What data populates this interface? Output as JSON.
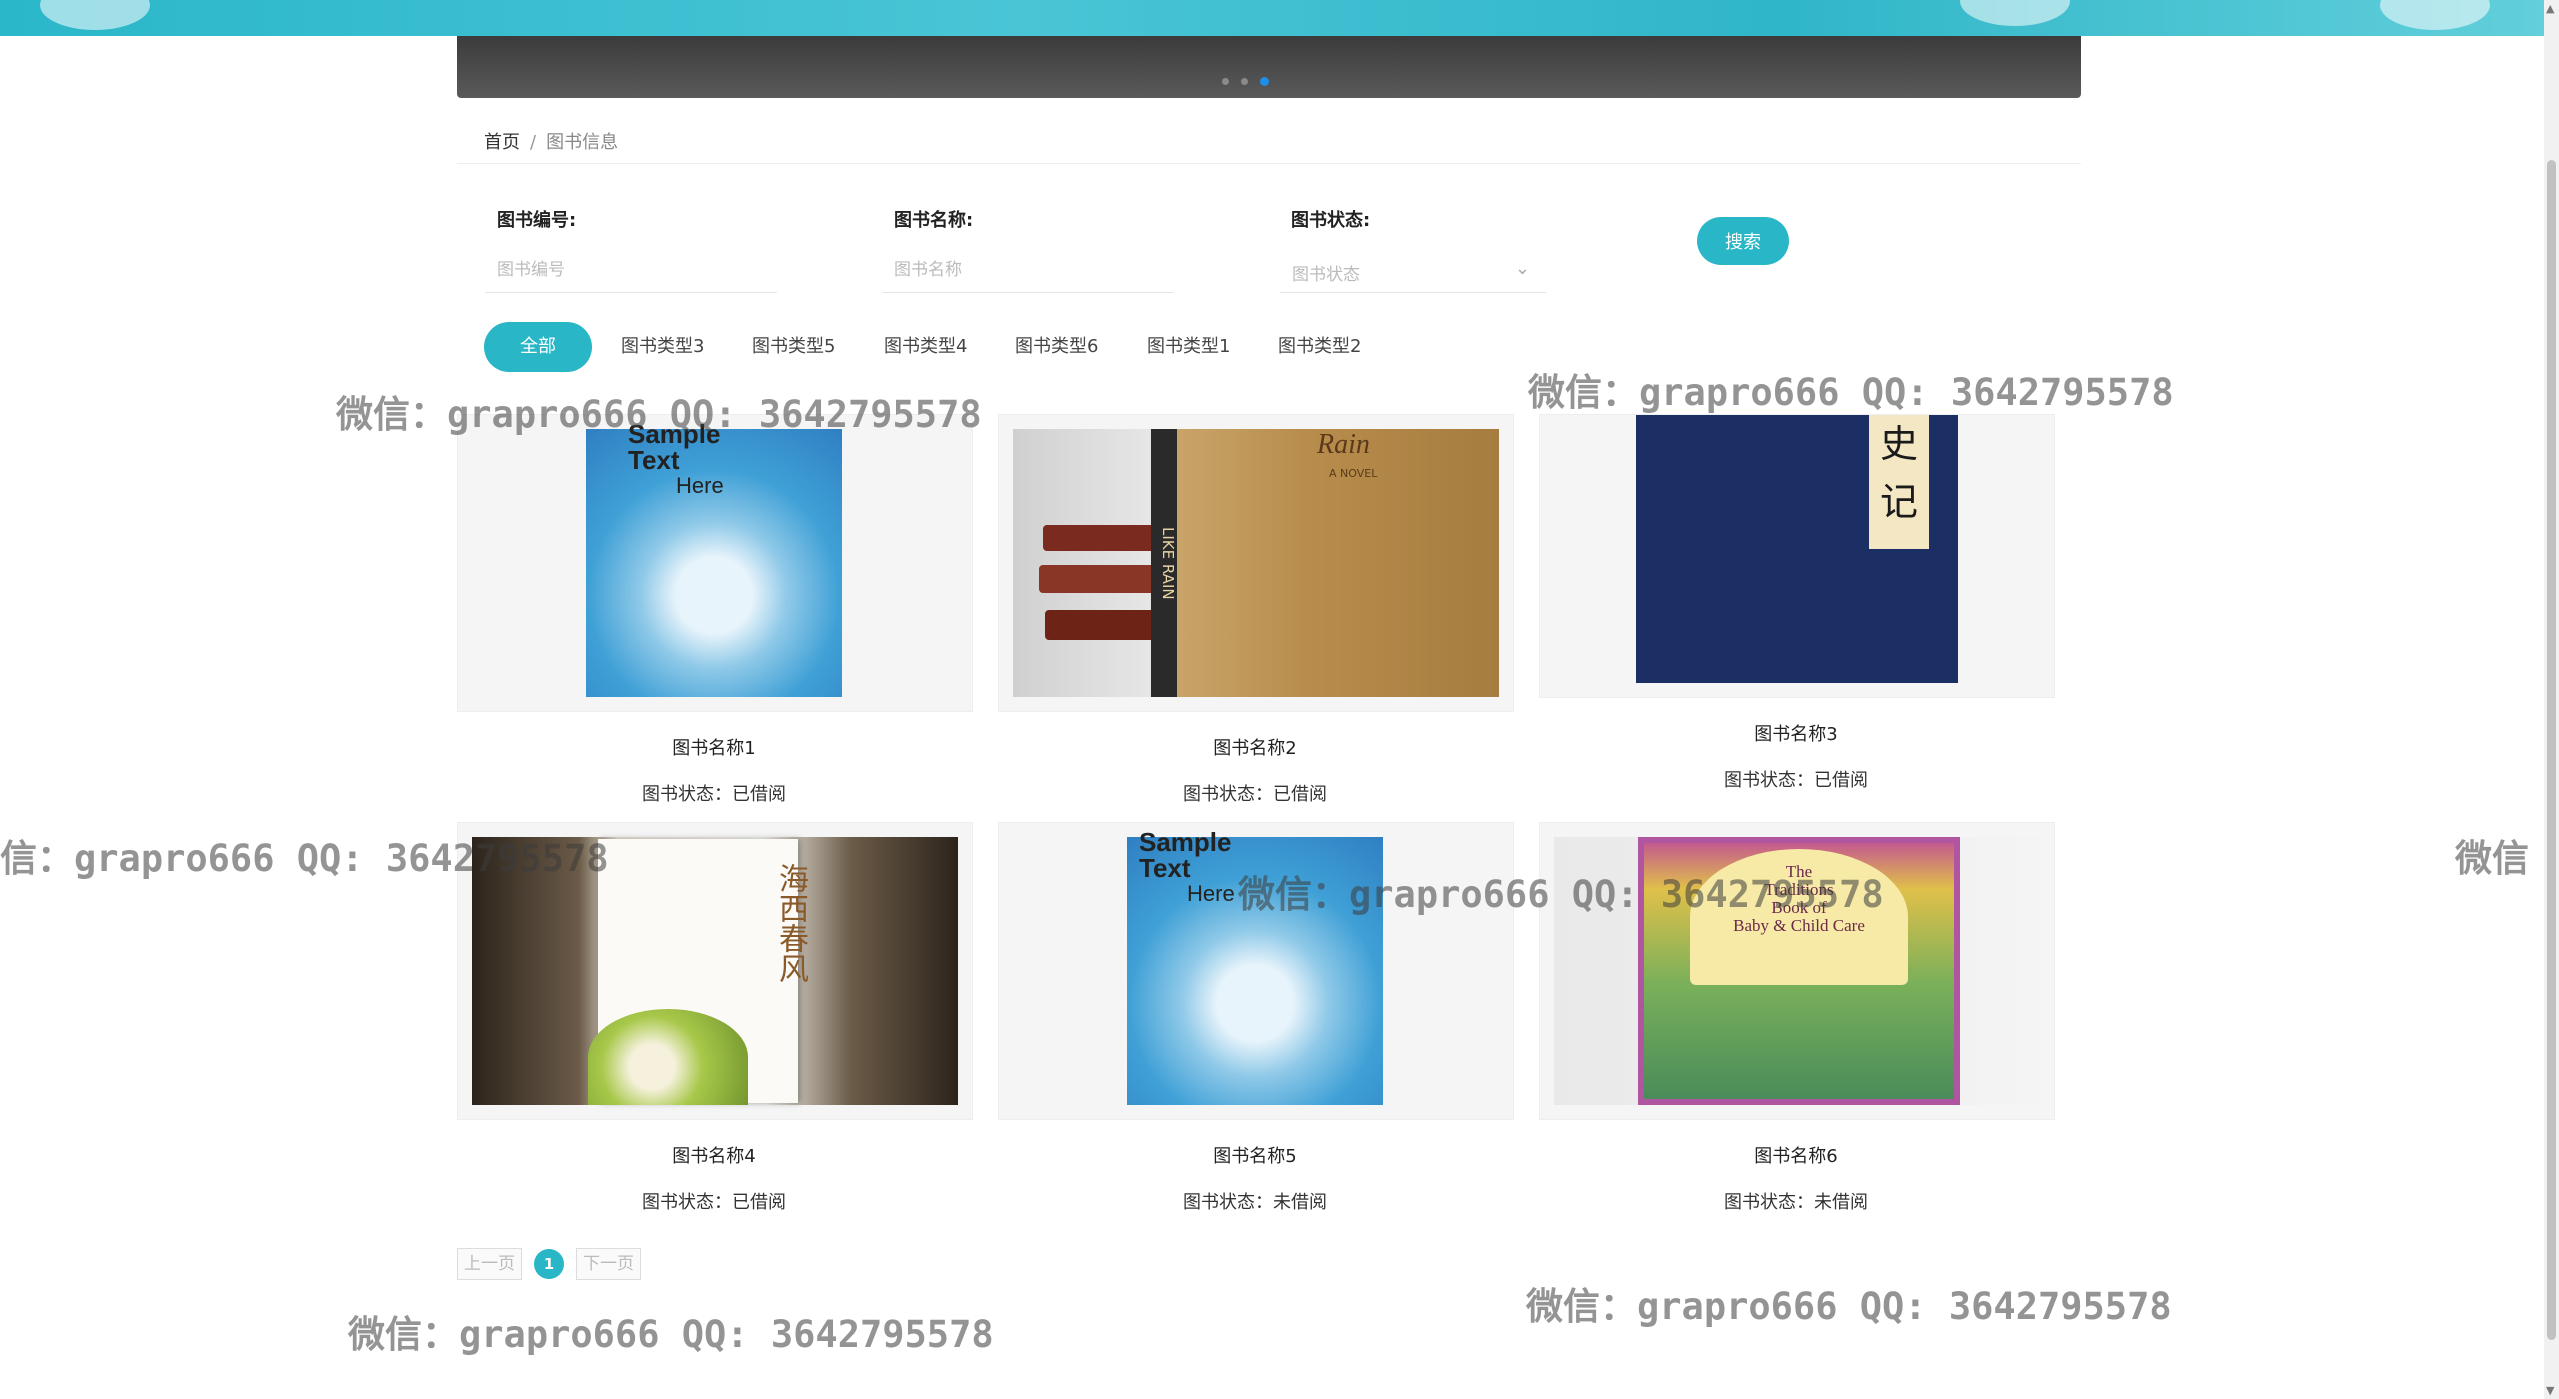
{
  "breadcrumb": {
    "home": "首页",
    "separator": "/",
    "current": "图书信息"
  },
  "filters": {
    "book_no": {
      "label": "图书编号:",
      "placeholder": "图书编号"
    },
    "book_name": {
      "label": "图书名称:",
      "placeholder": "图书名称"
    },
    "book_status": {
      "label": "图书状态:",
      "placeholder": "图书状态"
    },
    "search_label": "搜索"
  },
  "categories": [
    "全部",
    "图书类型3",
    "图书类型5",
    "图书类型4",
    "图书类型6",
    "图书类型1",
    "图书类型2"
  ],
  "books": [
    {
      "name": "图书名称1",
      "status": "图书状态：已借阅",
      "cover_text": [
        "Sample",
        "Text",
        "Here"
      ]
    },
    {
      "name": "图书名称2",
      "status": "图书状态：已借阅",
      "cover_text": [
        "Rain",
        "A NOVEL",
        "LIKE RAIN"
      ]
    },
    {
      "name": "图书名称3",
      "status": "图书状态：已借阅",
      "cover_text": [
        "史",
        "记"
      ]
    },
    {
      "name": "图书名称4",
      "status": "图书状态：已借阅",
      "cover_text": [
        "海西春风"
      ]
    },
    {
      "name": "图书名称5",
      "status": "图书状态：未借阅",
      "cover_text": [
        "Sample",
        "Text",
        "Here"
      ]
    },
    {
      "name": "图书名称6",
      "status": "图书状态：未借阅",
      "cover_text": [
        "The",
        "Traditions",
        "Book of",
        "Baby & Child Care"
      ]
    }
  ],
  "pagination": {
    "prev": "上一页",
    "current": "1",
    "next": "下一页"
  },
  "watermark": "微信：grapro666 QQ: 3642795578",
  "watermark_partial_left": "信：grapro666 QQ: 3642795578",
  "watermark_partial_right": "微信",
  "colors": {
    "accent": "#29b6c6",
    "active_dot": "#1e8fe8"
  }
}
